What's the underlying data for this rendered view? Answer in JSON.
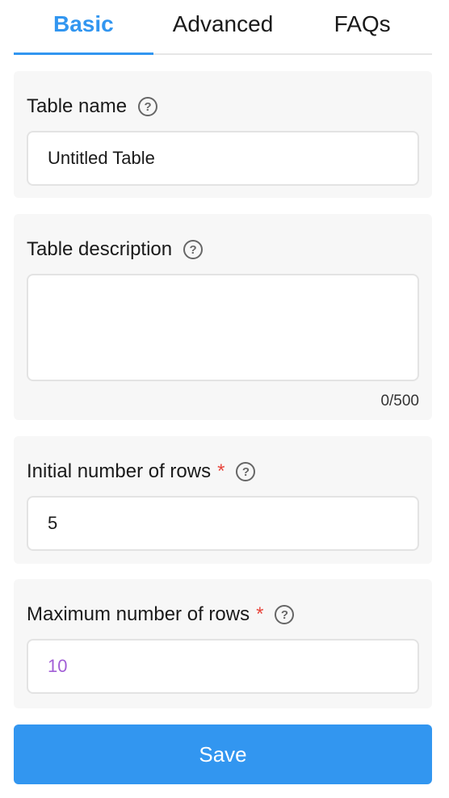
{
  "tabs": [
    {
      "label": "Basic",
      "active": true
    },
    {
      "label": "Advanced",
      "active": false
    },
    {
      "label": "FAQs",
      "active": false
    }
  ],
  "table_name": {
    "label": "Table name",
    "value": "Untitled Table",
    "help_icon": "question-circle-icon"
  },
  "table_description": {
    "label": "Table description",
    "value": "",
    "counter": "0/500",
    "help_icon": "question-circle-icon"
  },
  "initial_rows": {
    "label": "Initial number of rows",
    "required_mark": "*",
    "value": "5",
    "help_icon": "question-circle-icon"
  },
  "max_rows": {
    "label": "Maximum number of rows",
    "required_mark": "*",
    "value": "10",
    "help_icon": "question-circle-icon"
  },
  "save_label": "Save",
  "colors": {
    "accent": "#3296f0",
    "required": "#e8453c",
    "card_bg": "#f7f7f7",
    "value_purple": "#a25fd6"
  }
}
